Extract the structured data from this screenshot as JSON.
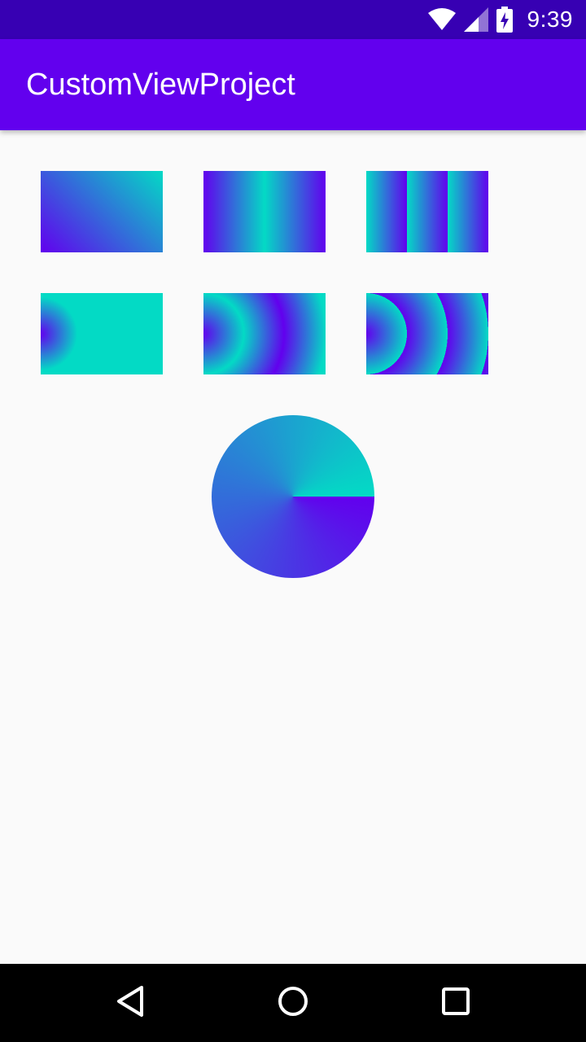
{
  "status_bar": {
    "time": "9:39",
    "icons": [
      "wifi-icon",
      "signal-icon",
      "battery-charging-icon"
    ]
  },
  "app_bar": {
    "title": "CustomViewProject"
  },
  "colors": {
    "primary": "#6200ee",
    "primary_dark": "#3700b3",
    "accent": "#03dac5",
    "background": "#fafafa"
  },
  "gradient_views": [
    {
      "kind": "linear",
      "tile_mode": "clamp"
    },
    {
      "kind": "linear",
      "tile_mode": "mirror"
    },
    {
      "kind": "linear",
      "tile_mode": "repeat"
    },
    {
      "kind": "radial",
      "tile_mode": "clamp"
    },
    {
      "kind": "radial",
      "tile_mode": "mirror"
    },
    {
      "kind": "radial",
      "tile_mode": "repeat"
    },
    {
      "kind": "sweep"
    }
  ],
  "nav_bar": {
    "buttons": [
      "back-icon",
      "home-icon",
      "recents-icon"
    ]
  }
}
